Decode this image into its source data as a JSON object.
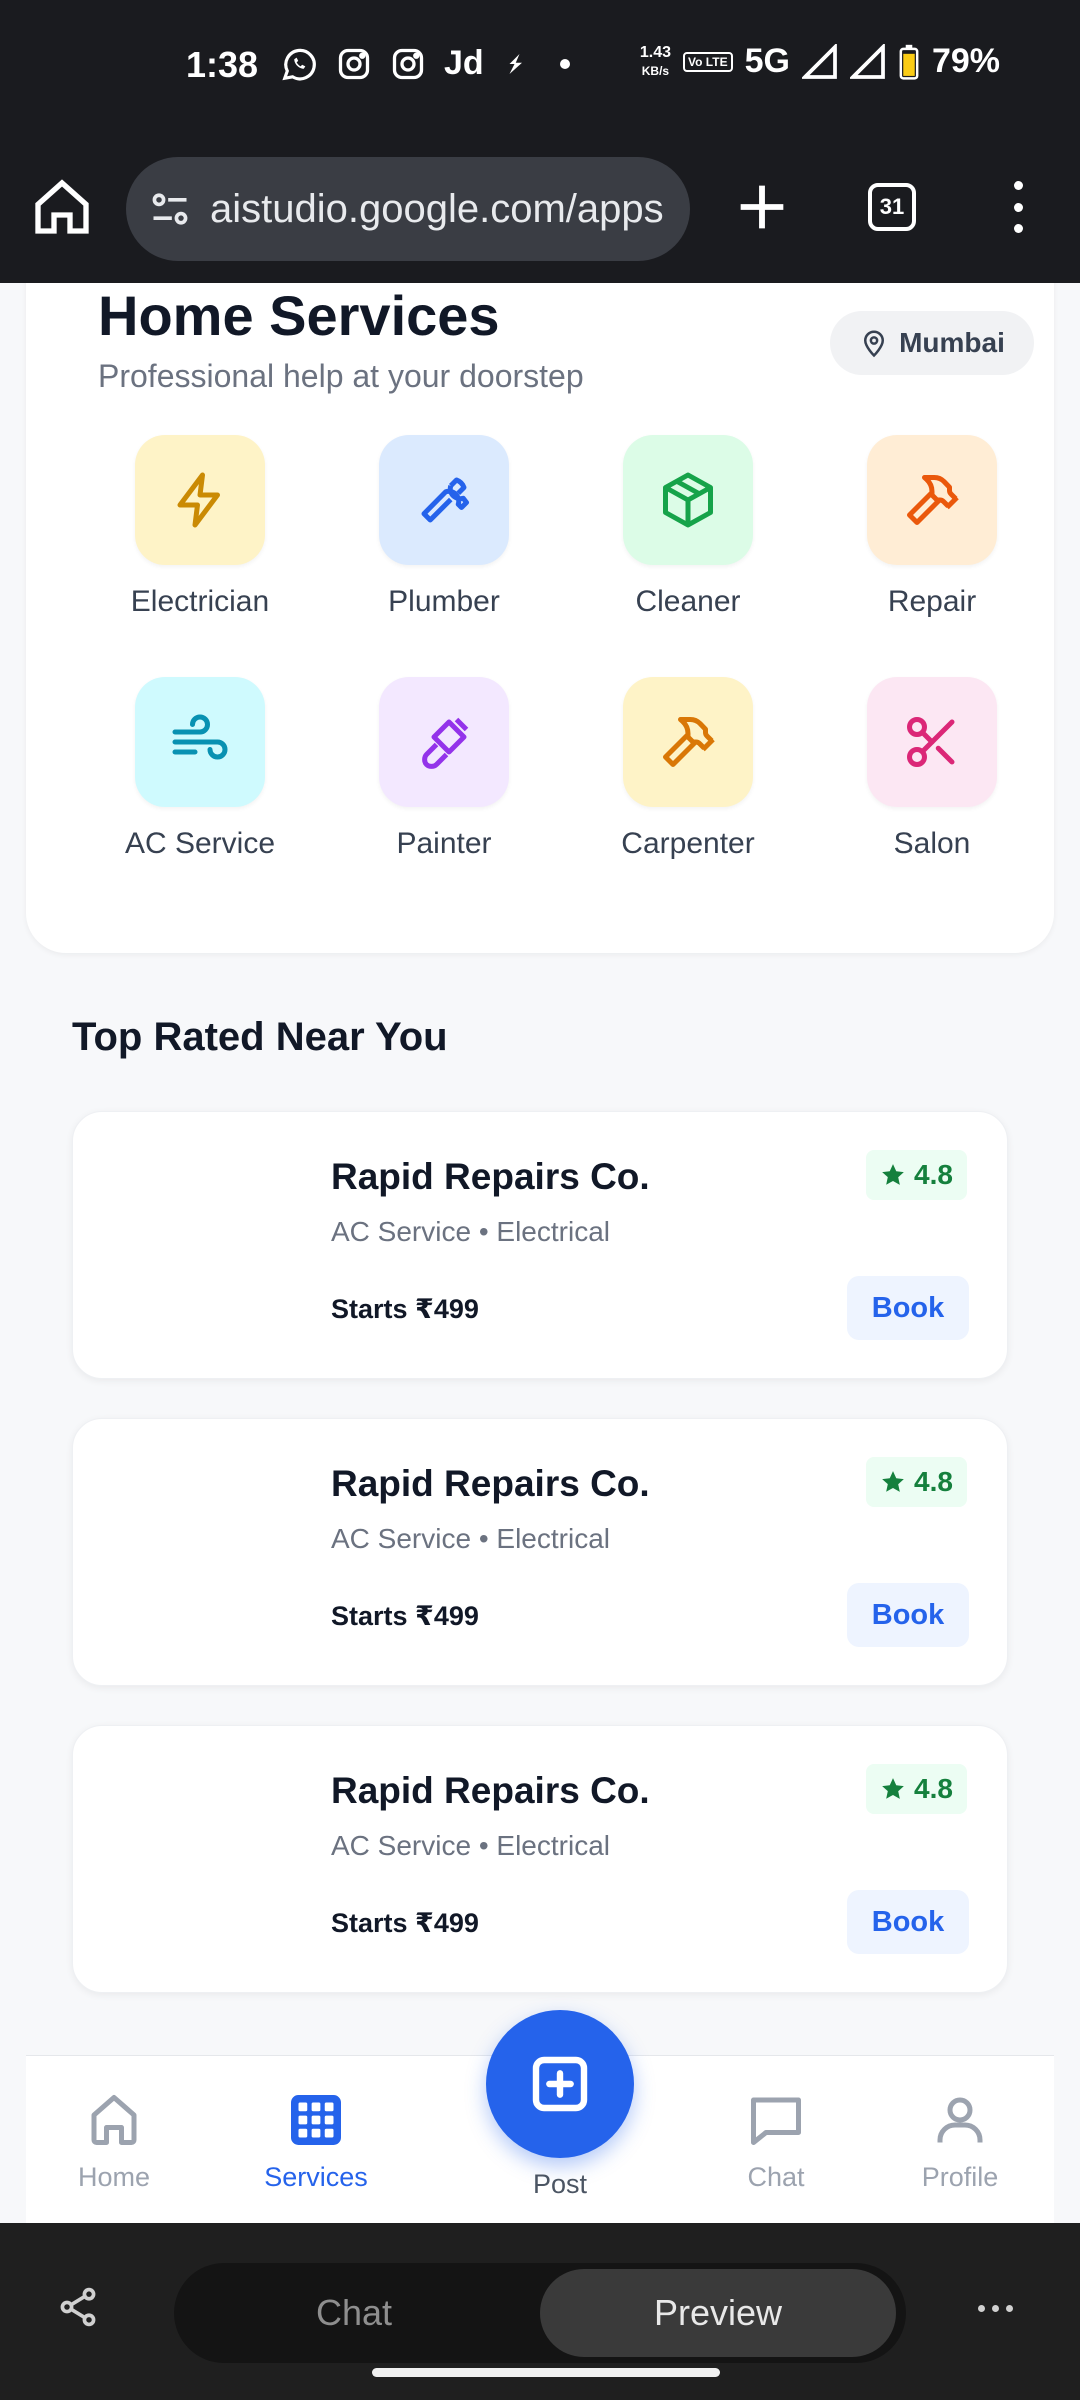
{
  "status_bar": {
    "time": "1:38",
    "speed_value": "1.43",
    "speed_unit": "KB/s",
    "volte": "Vo LTE",
    "network": "5G",
    "battery": "79%",
    "app_icons": [
      "whatsapp-icon",
      "instagram-icon",
      "instagram-icon",
      "jd-icon",
      "cursor-icon",
      "dot-icon"
    ]
  },
  "browser": {
    "url": "aistudio.google.com/apps",
    "tab_count": "31"
  },
  "header": {
    "title": "Home Services",
    "subtitle": "Professional help at your doorstep",
    "location": "Mumbai"
  },
  "categories": [
    {
      "label": "Electrician",
      "icon": "bolt-icon",
      "bg": "#fef3c7",
      "color": "#ca8a04"
    },
    {
      "label": "Plumber",
      "icon": "wrench-icon",
      "bg": "#dbeafe",
      "color": "#2563eb"
    },
    {
      "label": "Cleaner",
      "icon": "box-icon",
      "bg": "#dcfce7",
      "color": "#16a34a"
    },
    {
      "label": "Repair",
      "icon": "hammer-icon",
      "bg": "#ffedd5",
      "color": "#ea580c"
    },
    {
      "label": "AC Service",
      "icon": "wind-icon",
      "bg": "#cffafe",
      "color": "#0891b2"
    },
    {
      "label": "Painter",
      "icon": "paintbrush-icon",
      "bg": "#f3e8ff",
      "color": "#9333ea"
    },
    {
      "label": "Carpenter",
      "icon": "hammer-icon",
      "bg": "#fef3c7",
      "color": "#d97706"
    },
    {
      "label": "Salon",
      "icon": "scissors-icon",
      "bg": "#fce7f3",
      "color": "#db2777"
    }
  ],
  "top_rated": {
    "title": "Top Rated Near You",
    "providers": [
      {
        "name": "Rapid Repairs Co.",
        "meta": "AC Service • Electrical",
        "price": "Starts ₹499",
        "rating": "4.8",
        "book": "Book"
      },
      {
        "name": "Rapid Repairs Co.",
        "meta": "AC Service • Electrical",
        "price": "Starts ₹499",
        "rating": "4.8",
        "book": "Book"
      },
      {
        "name": "Rapid Repairs Co.",
        "meta": "AC Service • Electrical",
        "price": "Starts ₹499",
        "rating": "4.8",
        "book": "Book"
      }
    ]
  },
  "bottom_nav": {
    "home": "Home",
    "services": "Services",
    "post": "Post",
    "chat": "Chat",
    "profile": "Profile",
    "active": "services",
    "active_color": "#2563eb"
  },
  "studio_bar": {
    "chat": "Chat",
    "preview": "Preview"
  }
}
